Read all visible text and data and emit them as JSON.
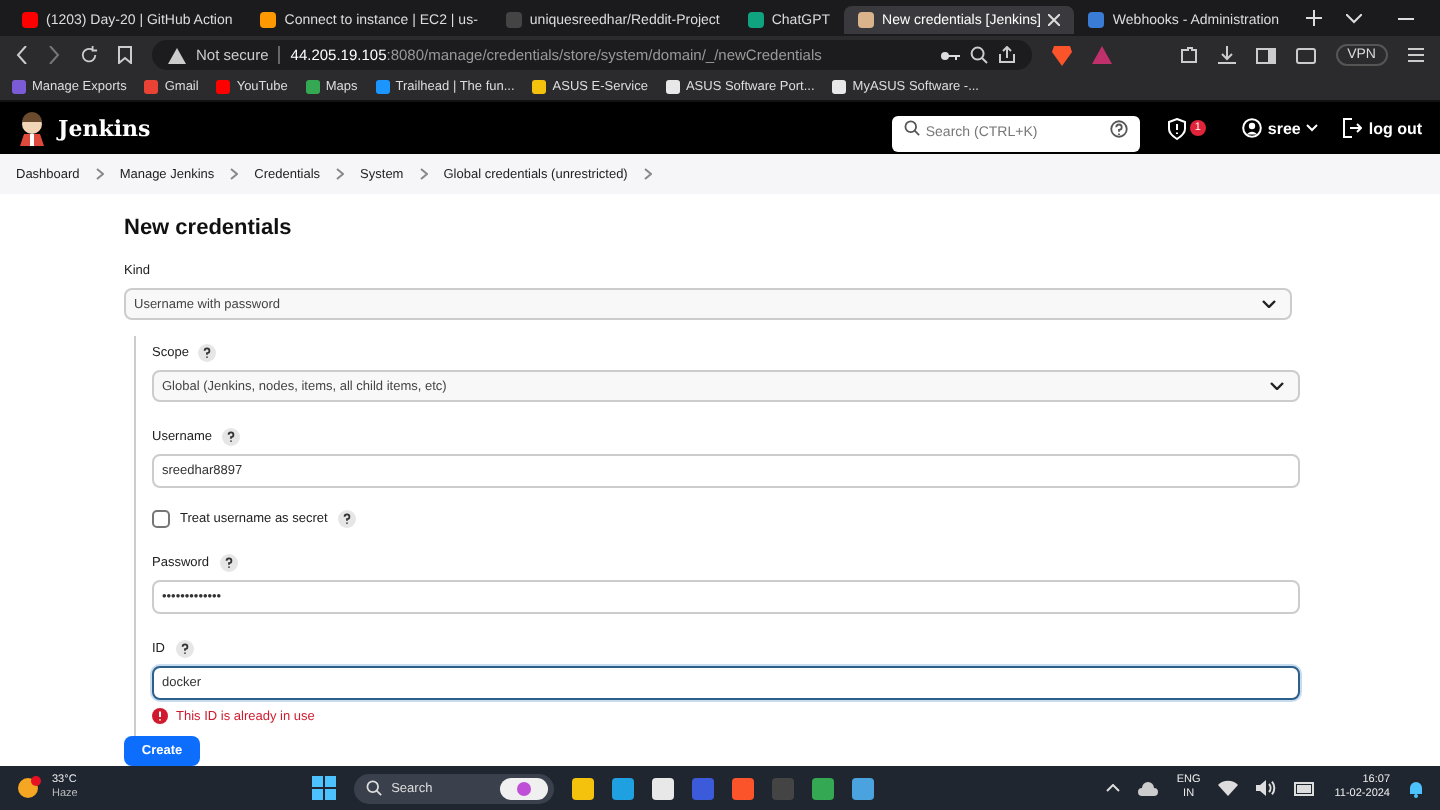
{
  "browser": {
    "tabs": [
      {
        "title": "(1203) Day-20 | GitHub Action",
        "selected": false
      },
      {
        "title": "Connect to instance | EC2 | us-",
        "selected": false
      },
      {
        "title": "uniquesreedhar/Reddit-Project",
        "selected": false
      },
      {
        "title": "ChatGPT",
        "selected": false
      },
      {
        "title": "New credentials [Jenkins]",
        "selected": true
      },
      {
        "title": "Webhooks - Administration",
        "selected": false
      }
    ],
    "address": {
      "security": "Not secure",
      "host": "44.205.19.105",
      "path": ":8080/manage/credentials/store/system/domain/_/newCredentials"
    },
    "vpn": "VPN",
    "bookmarks": [
      "Manage Exports",
      "Gmail",
      "YouTube",
      "Maps",
      "Trailhead | The fun...",
      "ASUS E-Service",
      "ASUS Software Port...",
      "MyASUS Software -..."
    ]
  },
  "header": {
    "brand": "Jenkins",
    "search": {
      "placeholder": "Search (CTRL+K)"
    },
    "alerts": "1",
    "user": "sree",
    "logout": "log out"
  },
  "breadcrumbs": [
    "Dashboard",
    "Manage Jenkins",
    "Credentials",
    "System",
    "Global credentials (unrestricted)"
  ],
  "form": {
    "title": "New credentials",
    "kind": {
      "label": "Kind",
      "value": "Username with password"
    },
    "details": [
      {
        "kind": "select",
        "label": "Scope",
        "value": "Global (Jenkins, nodes, items, all child items, etc)"
      },
      {
        "kind": "text",
        "label": "Username",
        "value": "sreedhar8897",
        "focused": false
      },
      {
        "kind": "checkbox",
        "label": "Treat username as secret",
        "checked": false
      },
      {
        "kind": "text",
        "label": "Password",
        "value": "•••••••••••••",
        "focused": false
      },
      {
        "kind": "text",
        "label": "ID",
        "value": "docker",
        "focused": true,
        "error": "This ID is already in use"
      }
    ],
    "submit": "Create"
  },
  "taskbar": {
    "weather": {
      "temperature": "33°C",
      "condition": "Haze"
    },
    "search": "Search",
    "language": "ENG",
    "region": "IN",
    "time": "16:07",
    "date": "11-02-2024"
  }
}
